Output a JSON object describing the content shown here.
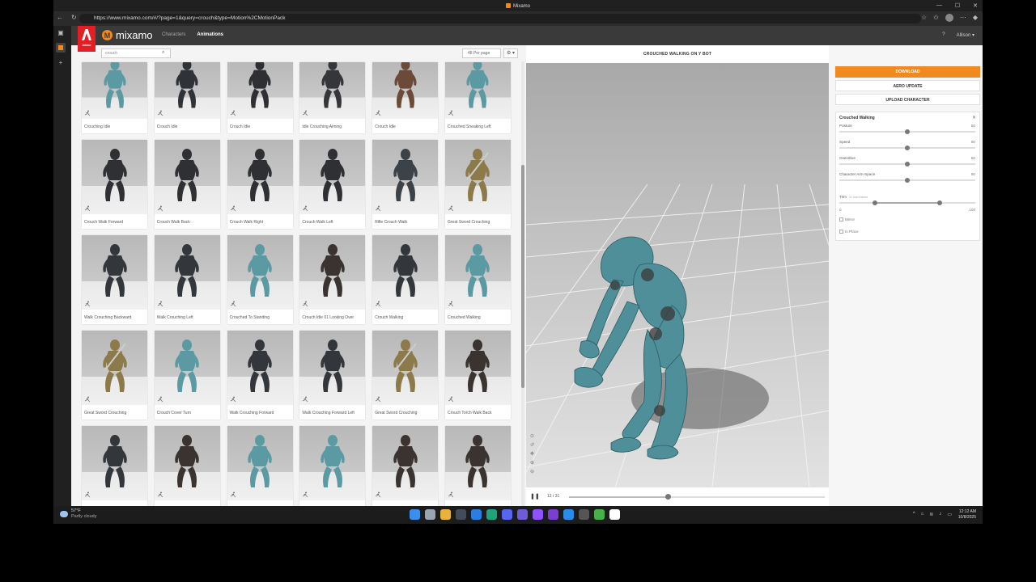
{
  "window": {
    "title": "Mixamo",
    "min_glyph": "—",
    "max_glyph": "☐",
    "close_glyph": "✕"
  },
  "browser": {
    "url": "https://www.mixamo.com/#/?page=1&query=crouch&type=Motion%2CMotionPack"
  },
  "header": {
    "adobe_label": "Adobe",
    "brand": "mixamo",
    "tabs": [
      {
        "label": "Characters"
      },
      {
        "label": "Animations"
      }
    ],
    "help_glyph": "?",
    "user_label": "Allison ▾"
  },
  "search": {
    "value": "crouch",
    "per_page": "48 Per page",
    "gear_glyph": "⚙ ▾"
  },
  "cards": [
    {
      "label": "Crouching Idle",
      "color": "#5c9aa3",
      "kind": "bot"
    },
    {
      "label": "Crouch Idle",
      "color": "#2f3338",
      "kind": "soldier"
    },
    {
      "label": "Crouch Idle",
      "color": "#2e2f33",
      "kind": "soldier"
    },
    {
      "label": "Idle Crouching Aiming",
      "color": "#34363a",
      "kind": "soldier"
    },
    {
      "label": "Crouch Idle",
      "color": "#6b4a3a",
      "kind": "soldier"
    },
    {
      "label": "Crouched Sneaking Left",
      "color": "#5c9aa3",
      "kind": "bot"
    },
    {
      "label": "Crouch Walk Forward",
      "color": "#2f3034",
      "kind": "hooded"
    },
    {
      "label": "Crouch Walk Back",
      "color": "#2f3034",
      "kind": "hooded"
    },
    {
      "label": "Crouch Walk Right",
      "color": "#2f3034",
      "kind": "hooded"
    },
    {
      "label": "Crouch Walk Left",
      "color": "#2f3034",
      "kind": "hooded"
    },
    {
      "label": "Rifle Crouch Walk",
      "color": "#3b4248",
      "kind": "soldier"
    },
    {
      "label": "Great Sword Crouching",
      "color": "#8d7a4a",
      "kind": "knight"
    },
    {
      "label": "Walk Crouching Backward",
      "color": "#33373c",
      "kind": "soldier"
    },
    {
      "label": "Walk Crouching Left",
      "color": "#33373c",
      "kind": "soldier"
    },
    {
      "label": "Crouched To Standing",
      "color": "#5c9aa3",
      "kind": "bot"
    },
    {
      "label": "Crouch Idle 01 Looking Over",
      "color": "#3a3330",
      "kind": "archer"
    },
    {
      "label": "Crouch Walking",
      "color": "#33373c",
      "kind": "soldier"
    },
    {
      "label": "Crouched Walking",
      "color": "#5c9aa3",
      "kind": "bot"
    },
    {
      "label": "Great Sword Crouching",
      "color": "#8d7a4a",
      "kind": "knight"
    },
    {
      "label": "Crouch Cover Turn",
      "color": "#5c9aa3",
      "kind": "bot"
    },
    {
      "label": "Walk Crouching Forward",
      "color": "#33373c",
      "kind": "soldier"
    },
    {
      "label": "Walk Crouching Forward Left",
      "color": "#33373c",
      "kind": "soldier"
    },
    {
      "label": "Great Sword Crouching",
      "color": "#8d7a4a",
      "kind": "knight"
    },
    {
      "label": "Crouch Torch Walk Back",
      "color": "#3a3330",
      "kind": "archer"
    },
    {
      "label": "",
      "color": "#33373c",
      "kind": "soldier"
    },
    {
      "label": "",
      "color": "#3a3330",
      "kind": "archer"
    },
    {
      "label": "",
      "color": "#5c9aa3",
      "kind": "bot"
    },
    {
      "label": "",
      "color": "#5c9aa3",
      "kind": "bot"
    },
    {
      "label": "",
      "color": "#3a3330",
      "kind": "archer"
    },
    {
      "label": "",
      "color": "#3a3330",
      "kind": "archer"
    }
  ],
  "viewer": {
    "title": "CROUCHED WALKING ON Y BOT",
    "frame": "12 / 31",
    "frame_index": 12,
    "frame_total": 31,
    "pause_glyph": "❚❚",
    "tool_glyphs": [
      "⊙",
      "↺",
      "✥",
      "⊕",
      "⊖"
    ]
  },
  "panel": {
    "download": "DOWNLOAD",
    "aero": "AERO UPDATE",
    "upload": "UPLOAD CHARACTER",
    "settings_title": "Crouched Walking",
    "close_glyph": "✕",
    "sliders": [
      {
        "label": "Posture",
        "value": "50",
        "fraction": 0.5
      },
      {
        "label": "Speed",
        "value": "50",
        "fraction": 0.5
      },
      {
        "label": "Overdrive",
        "value": "50",
        "fraction": 0.5
      },
      {
        "label": "Character Arm-Space",
        "value": "50",
        "fraction": 0.5
      }
    ],
    "trim": {
      "label": "Trim",
      "sub": "31 total frames",
      "min": "0",
      "max": "100",
      "start": 0.26,
      "end": 0.74
    },
    "mirror": "Mirror",
    "in_place": "In Place"
  },
  "taskbar": {
    "temp": "57°F",
    "weather": "Partly cloudy",
    "time": "12:12 AM",
    "date": "10/8/2025",
    "icons": [
      "#3b8eea",
      "#9aa4b0",
      "#e8b33a",
      "#444c5a",
      "#2b7de0",
      "#1fa37d",
      "#5865f2",
      "#6e5bd8",
      "#8c52ff",
      "#7a3fd0",
      "#2c8ae8",
      "#555",
      "#47b04b",
      "#ffffff"
    ]
  }
}
